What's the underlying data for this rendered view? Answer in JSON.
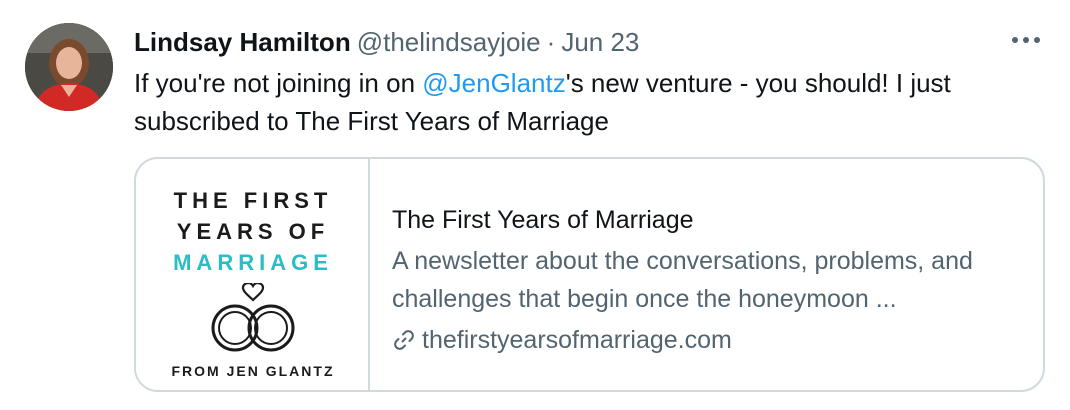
{
  "tweet": {
    "author": {
      "display_name": "Lindsay Hamilton",
      "handle": "@thelindsayjoie",
      "avatar": "profile-photo"
    },
    "separator": "·",
    "date": "Jun 23",
    "more_icon": "more-horizontal-icon",
    "text_before": "If you're not joining in on ",
    "mention": "@JenGlantz",
    "text_after": "'s new venture - you should! I just subscribed to The First Years of Marriage"
  },
  "card": {
    "thumbnail": {
      "line1": "THE FIRST",
      "line2": "YEARS OF",
      "line3": "MARRIAGE",
      "byline": "FROM JEN GLANTZ",
      "accent": "#2bbdc5"
    },
    "title": "The First Years of Marriage",
    "description": "A newsletter about the conversations, problems, and challenges that begin once the honeymoon ...",
    "url": "thefirstyearsofmarriage.com",
    "link_icon": "link-icon"
  },
  "colors": {
    "mention": "#1d9bf0",
    "secondary_text": "#536471",
    "border": "#cfd9de"
  }
}
